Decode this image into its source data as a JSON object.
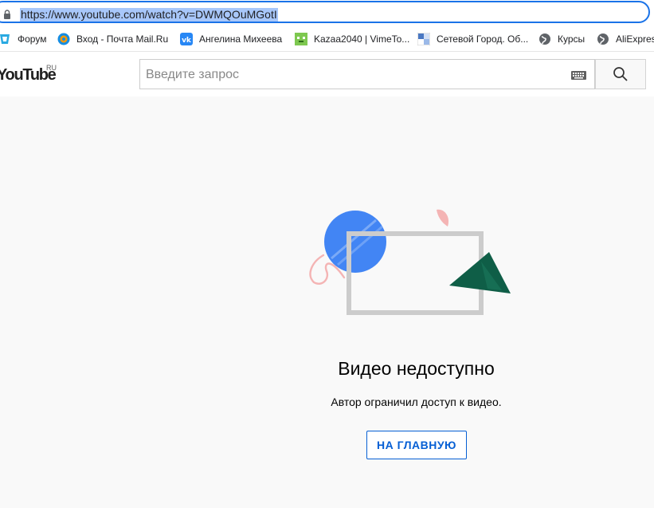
{
  "browser": {
    "url": "https://www.youtube.com/watch?v=DWMQOuMGotI"
  },
  "bookmarks": [
    {
      "label": "Форум",
      "icon": "forum-icon"
    },
    {
      "label": "Вход - Почта Mail.Ru",
      "icon": "mailru-icon"
    },
    {
      "label": "Ангелина Михеева",
      "icon": "vk-icon"
    },
    {
      "label": "Kazaa2040 | VimeTo...",
      "icon": "vimetop-icon"
    },
    {
      "label": "Сетевой Город. Об...",
      "icon": "netcity-icon"
    },
    {
      "label": "Курсы",
      "icon": "globe-icon"
    },
    {
      "label": "AliExpress",
      "icon": "globe-icon"
    }
  ],
  "youtube": {
    "logo": "YouTube",
    "region": "RU",
    "search_placeholder": "Введите запрос"
  },
  "error": {
    "title": "Видео недоступно",
    "message": "Автор ограничил доступ к видео.",
    "button": "НА ГЛАВНУЮ"
  },
  "colors": {
    "accent": "#065fd4",
    "focus_ring": "#1a73e8",
    "selection": "#a8c7fa",
    "illus_blue": "#4285f4",
    "illus_green": "#0f5e47",
    "illus_pink": "#f4b4b4"
  }
}
